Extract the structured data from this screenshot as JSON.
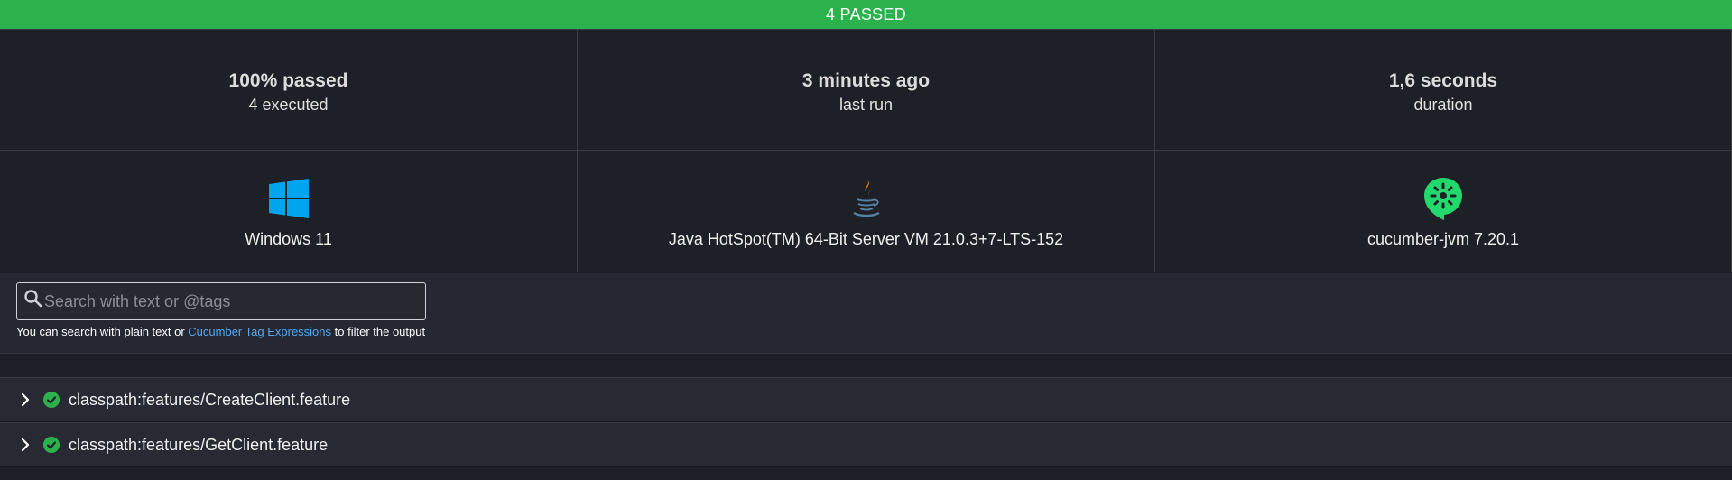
{
  "banner": {
    "text": "4 PASSED",
    "color": "#2bb24c"
  },
  "stats": {
    "passed": {
      "value": "100% passed",
      "sub": "4 executed"
    },
    "last_run": {
      "value": "3 minutes ago",
      "sub": "last run"
    },
    "duration": {
      "value": "1,6 seconds",
      "sub": "duration"
    }
  },
  "environment": {
    "os": {
      "label": "Windows 11",
      "icon": "windows-icon",
      "color": "#00a4ef"
    },
    "runtime": {
      "label": "Java HotSpot(TM) 64-Bit Server VM 21.0.3+7-LTS-152",
      "icon": "java-icon"
    },
    "implementation": {
      "label": "cucumber-jvm 7.20.1",
      "icon": "cucumber-icon",
      "color": "#23d96c"
    }
  },
  "search": {
    "placeholder": "Search with text or @tags",
    "value": "",
    "hint_prefix": "You can search with plain text or ",
    "hint_link": "Cucumber Tag Expressions",
    "hint_suffix": " to filter the output"
  },
  "features": [
    {
      "name": "classpath:features/CreateClient.feature",
      "status": "passed"
    },
    {
      "name": "classpath:features/GetClient.feature",
      "status": "passed"
    }
  ],
  "colors": {
    "background": "#1d1f26",
    "passed": "#2bb24c",
    "link": "#56a8f0"
  }
}
